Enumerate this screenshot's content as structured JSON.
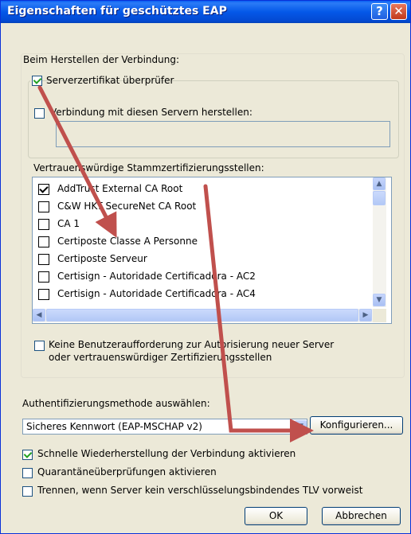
{
  "window": {
    "title": "Eigenschaften für geschütztes EAP",
    "help_icon": "?",
    "close_icon": "✕"
  },
  "connect": {
    "heading": "Beim Herstellen der Verbindung:",
    "verify_cert": {
      "label": "Serverzertifikat überprüfer",
      "checked": true
    },
    "connect_servers": {
      "label": "Verbindung mit diesen Servern herstellen:",
      "checked": false,
      "value": ""
    },
    "trusted_ca_heading": "Vertrauenswürdige Stammzertifizierungsstellen:",
    "ca_list": [
      {
        "name": "AddTrust External CA Root",
        "checked": true
      },
      {
        "name": "C&W HKT SecureNet CA Root",
        "checked": false
      },
      {
        "name": "CA 1",
        "checked": false
      },
      {
        "name": "Certiposte Classe A Personne",
        "checked": false
      },
      {
        "name": "Certiposte Serveur",
        "checked": false
      },
      {
        "name": "Certisign - Autoridade Certificadora - AC2",
        "checked": false
      },
      {
        "name": "Certisign - Autoridade Certificadora - AC4",
        "checked": false
      }
    ],
    "no_prompt": {
      "line1": "Keine Benutzeraufforderung zur Autorisierung neuer Server",
      "line2": "oder vertrauenswürdiger Zertifizierungsstellen",
      "checked": false
    }
  },
  "auth": {
    "heading": "Authentifizierungsmethode auswählen:",
    "method": "Sicheres Kennwort (EAP-MSCHAP v2)",
    "configure_label": "Konfigurieren..."
  },
  "options": {
    "fast_reconnect": {
      "label": "Schnelle Wiederherstellung der Verbindung aktivieren",
      "checked": true
    },
    "quarantine": {
      "label": "Quarantäneüberprüfungen aktivieren",
      "checked": false
    },
    "disconnect_tlv": {
      "label": "Trennen, wenn Server kein verschlüsselungsbindendes TLV vorweist",
      "checked": false
    }
  },
  "buttons": {
    "ok": "OK",
    "cancel": "Abbrechen"
  },
  "colors": {
    "titlebar": "#0458e8",
    "dialog": "#ece9d8",
    "annotation_arrow": "#c0504d"
  }
}
